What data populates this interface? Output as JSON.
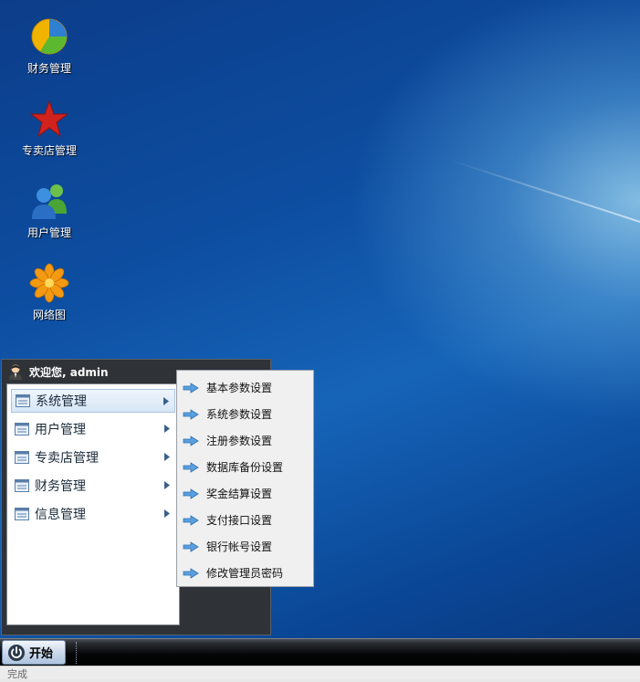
{
  "desktop": {
    "icons": [
      {
        "label": "财务管理",
        "icon": "pie-chart-icon"
      },
      {
        "label": "专卖店管理",
        "icon": "red-star-icon"
      },
      {
        "label": "用户管理",
        "icon": "users-icon"
      },
      {
        "label": "网络图",
        "icon": "flower-icon"
      }
    ]
  },
  "start_menu": {
    "welcome": "欢迎您, admin",
    "items": [
      {
        "label": "系统管理",
        "active": true
      },
      {
        "label": "用户管理",
        "active": false
      },
      {
        "label": "专卖店管理",
        "active": false
      },
      {
        "label": "财务管理",
        "active": false
      },
      {
        "label": "信息管理",
        "active": false
      }
    ]
  },
  "submenu": {
    "items": [
      {
        "label": "基本参数设置"
      },
      {
        "label": "系统参数设置"
      },
      {
        "label": "注册参数设置"
      },
      {
        "label": "数据库备份设置"
      },
      {
        "label": "奖金结算设置"
      },
      {
        "label": "支付接口设置"
      },
      {
        "label": "银行帐号设置"
      },
      {
        "label": "修改管理员密码"
      }
    ]
  },
  "taskbar": {
    "start_label": "开始"
  },
  "statusbar": {
    "text": "完成"
  },
  "colors": {
    "desktop_blue": "#0d4da0",
    "menu_dark": "#2f3338",
    "submenu_bg": "#f0f0f0"
  }
}
